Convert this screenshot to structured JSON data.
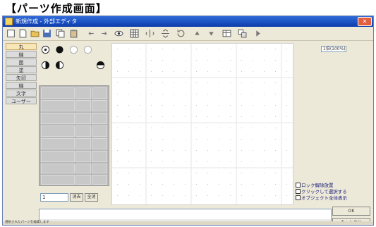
{
  "page_caption": "【パーツ作成画面】",
  "window": {
    "title": "新規作成 - 外部エディタ",
    "close_label": "✕"
  },
  "toolbar": {
    "buttons": [
      {
        "icon": "square-icon"
      },
      {
        "icon": "document-icon"
      },
      {
        "icon": "folder-open-icon"
      },
      {
        "icon": "save-icon"
      },
      {
        "icon": "copy-icon"
      },
      {
        "icon": "paste-icon"
      },
      {
        "icon": "arrow-left-icon"
      },
      {
        "icon": "arrow-right-icon"
      },
      {
        "icon": "eye-icon"
      },
      {
        "icon": "grid-icon"
      },
      {
        "icon": "flip-horizontal-icon"
      },
      {
        "icon": "flip-vertical-icon"
      },
      {
        "icon": "rotate-icon"
      },
      {
        "icon": "triangle-up-icon"
      },
      {
        "icon": "triangle-down-icon"
      },
      {
        "icon": "table-icon"
      },
      {
        "icon": "layers-icon"
      },
      {
        "icon": "play-icon"
      }
    ]
  },
  "sidebar": {
    "items": [
      {
        "label": "丸",
        "active": true
      },
      {
        "label": "線"
      },
      {
        "label": "面"
      },
      {
        "label": "塗"
      },
      {
        "label": "矢印"
      },
      {
        "label": "線"
      },
      {
        "label": "文字"
      },
      {
        "label": "ユーザー"
      }
    ]
  },
  "shapes": [
    {
      "icon": "target-circle-icon"
    },
    {
      "icon": "filled-circle-icon"
    },
    {
      "icon": "empty-circle-icon"
    },
    {
      "icon": "empty-circle-icon"
    },
    {
      "icon": "half-filled-circle-icon"
    },
    {
      "icon": "half-filled-circle-icon"
    },
    {
      "icon": "half-filled-circle-icon"
    }
  ],
  "panel_bottom": {
    "size_value": "1",
    "btn1": "消去",
    "btn2": "全消"
  },
  "right_panel": {
    "zoom_value": "1倍(100%)",
    "options": [
      "ロック解除放置",
      "クリックして選択する",
      "オブジェクト全体表示"
    ]
  },
  "buttons": {
    "ok": "OK",
    "cancel": "キャンセル"
  },
  "status": {
    "text": "選択されたパーツを編集します"
  }
}
